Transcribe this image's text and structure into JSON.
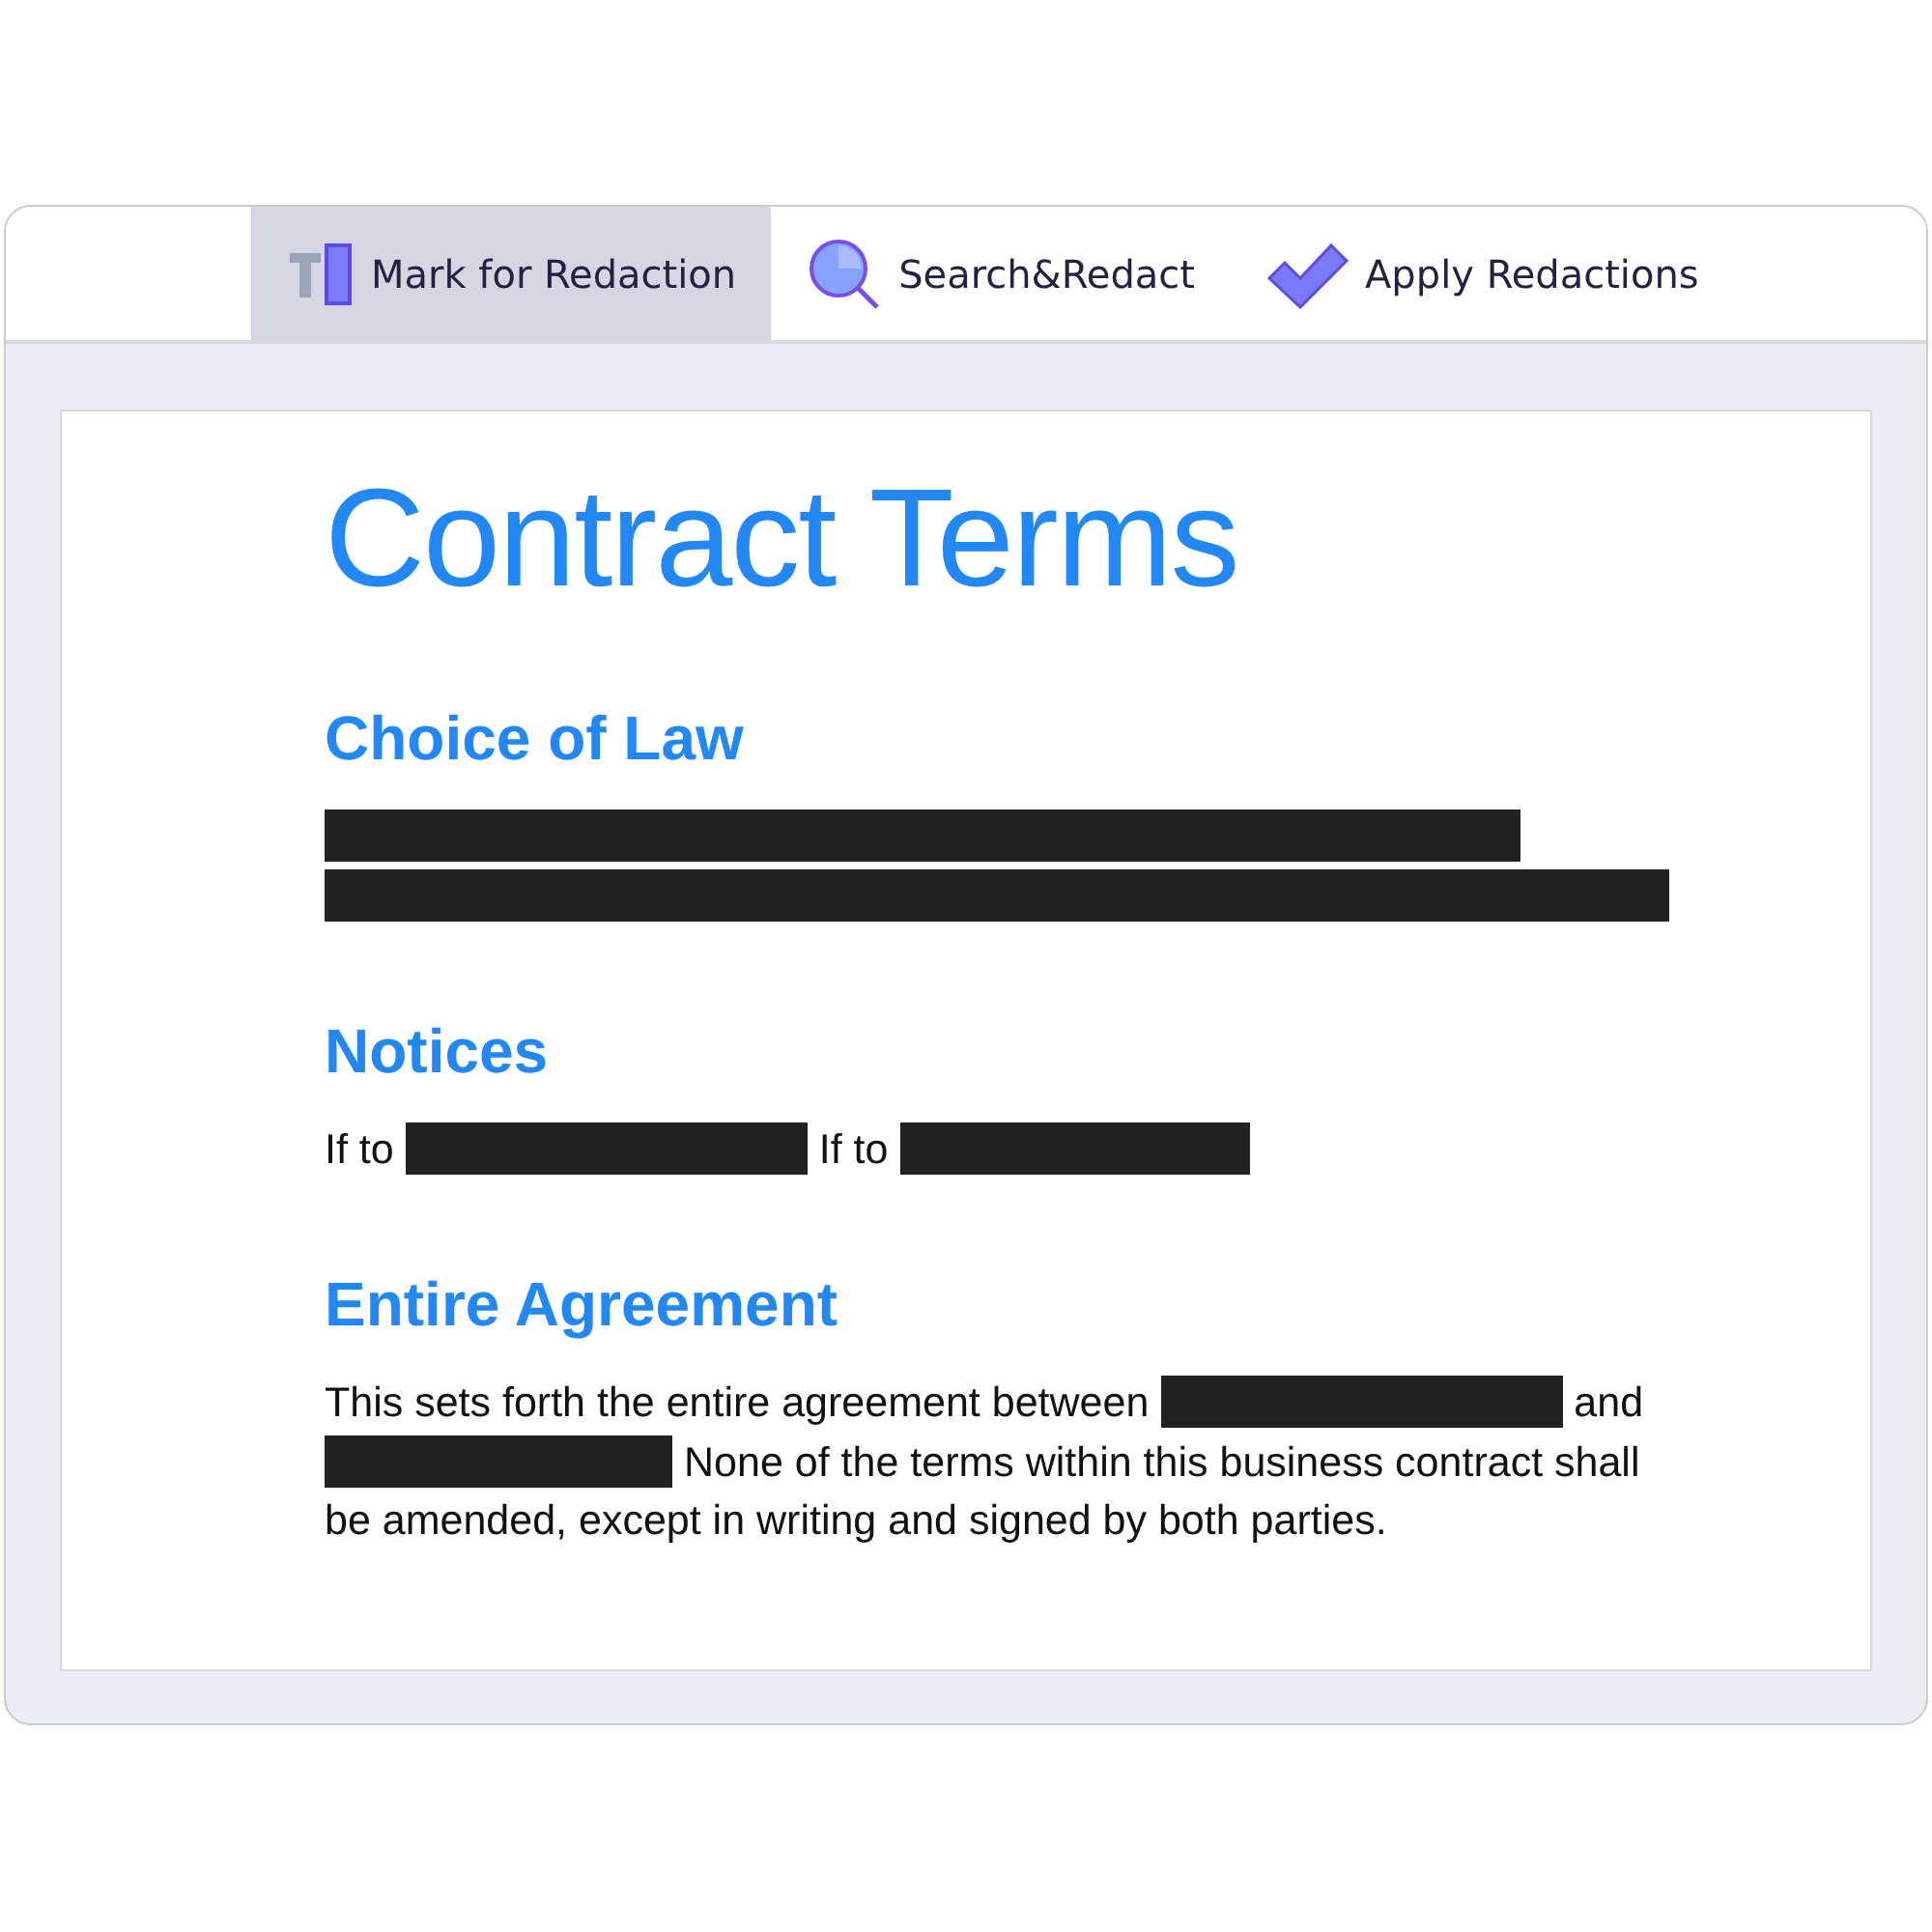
{
  "toolbar": [
    {
      "label": "Mark for Redaction",
      "kind": "mark",
      "selected": true
    },
    {
      "label": "Search&Redact",
      "kind": "search",
      "selected": false
    },
    {
      "label": "Apply Redactions",
      "kind": "apply",
      "selected": false
    }
  ],
  "document": {
    "title": "Contract Terms",
    "sections": [
      {
        "heading": "Choice of Law",
        "paragraph": [
          {
            "kind": "redaction"
          },
          {
            "kind": "redaction"
          }
        ]
      },
      {
        "heading": "Notices",
        "paragraph": [
          {
            "kind": "text",
            "text": "If to"
          },
          {
            "kind": "redaction"
          },
          {
            "kind": "text",
            "text": "If to"
          },
          {
            "kind": "redaction"
          }
        ]
      },
      {
        "heading": "Entire Agreement",
        "paragraph": [
          {
            "kind": "text",
            "text": "This sets forth the entire agreement between"
          },
          {
            "kind": "redaction"
          },
          {
            "kind": "text",
            "text": "and"
          },
          {
            "kind": "redaction"
          },
          {
            "kind": "text",
            "text": "None of the terms within this business contract shall"
          },
          {
            "kind": "text",
            "text": "be amended, except in writing and signed by both parties."
          }
        ]
      }
    ]
  }
}
